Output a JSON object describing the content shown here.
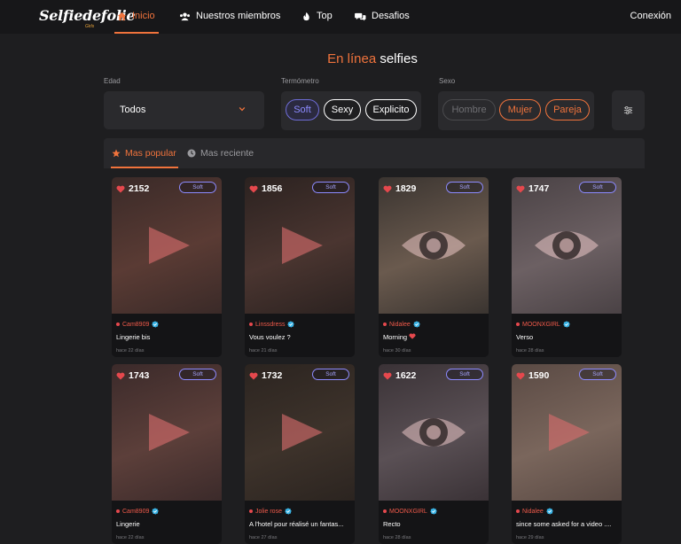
{
  "brand": {
    "logo": "Selfiedefolie",
    "sub": "Girls"
  },
  "nav": {
    "items": [
      {
        "label": "Inicio",
        "icon": "home-icon",
        "active": true
      },
      {
        "label": "Nuestros miembros",
        "icon": "users-icon"
      },
      {
        "label": "Top",
        "icon": "fire-icon"
      },
      {
        "label": "Desafios",
        "icon": "chat-icon"
      }
    ],
    "login": "Conexión"
  },
  "heading": {
    "prefix": "En línea",
    "rest": " selfies"
  },
  "filters": {
    "age": {
      "label": "Edad",
      "value": "Todos"
    },
    "thermo": {
      "label": "Termómetro",
      "options": [
        "Soft",
        "Sexy",
        "Explicito"
      ],
      "selected": "Soft"
    },
    "sex": {
      "label": "Sexo",
      "options": [
        "Hombre",
        "Mujer",
        "Pareja"
      ],
      "selected": [
        "Mujer",
        "Pareja"
      ]
    }
  },
  "tabs": [
    {
      "label": "Mas popular",
      "icon": "star-icon",
      "active": true
    },
    {
      "label": "Mas reciente",
      "icon": "clock-icon",
      "active": false
    }
  ],
  "cards": [
    {
      "likes": "2152",
      "badge": "Soft",
      "user": "Cam8909",
      "title": "Lingerie bis",
      "date": "hace 22 días",
      "media": "video",
      "tint": [
        "#3a2a28",
        "#5a3b34"
      ]
    },
    {
      "likes": "1856",
      "badge": "Soft",
      "user": "Linssdress",
      "title": "Vous voulez ?",
      "date": "hace 21 días",
      "media": "video",
      "tint": [
        "#2b2220",
        "#4a3530"
      ]
    },
    {
      "likes": "1829",
      "badge": "Soft",
      "user": "Nidalee",
      "title": "Morning",
      "date": "hace 30 días",
      "media": "eye",
      "tint": [
        "#3a3430",
        "#6a5a4e"
      ],
      "heart": true
    },
    {
      "likes": "1747",
      "badge": "Soft",
      "user": "MOONXGIRL",
      "title": "Verso",
      "date": "hace 28 días",
      "media": "eye",
      "tint": [
        "#4a4245",
        "#6c6063"
      ]
    },
    {
      "likes": "1743",
      "badge": "Soft",
      "user": "Cam8909",
      "title": "Lingerie",
      "date": "hace 22 días",
      "media": "video",
      "tint": [
        "#3b2a2a",
        "#5c3f3a"
      ]
    },
    {
      "likes": "1732",
      "badge": "Soft",
      "user": "Jolie rose",
      "title": "A l'hotel pour réalisé un fantas...",
      "date": "hace 27 días",
      "media": "video",
      "tint": [
        "#2b2420",
        "#3e332b"
      ]
    },
    {
      "likes": "1622",
      "badge": "Soft",
      "user": "MOONXGIRL",
      "title": "Recto",
      "date": "hace 28 días",
      "media": "eye",
      "tint": [
        "#3a3236",
        "#5a5055"
      ]
    },
    {
      "likes": "1590",
      "badge": "Soft",
      "user": "Nidalee",
      "title": "since some asked for a video ....",
      "date": "hace 29 días",
      "media": "video",
      "tint": [
        "#5a4a44",
        "#7a665c"
      ]
    }
  ],
  "colors": {
    "accent": "#f0733c",
    "soft": "#8d8bff",
    "verified": "#3ab4e6",
    "like": "#e5484d"
  }
}
